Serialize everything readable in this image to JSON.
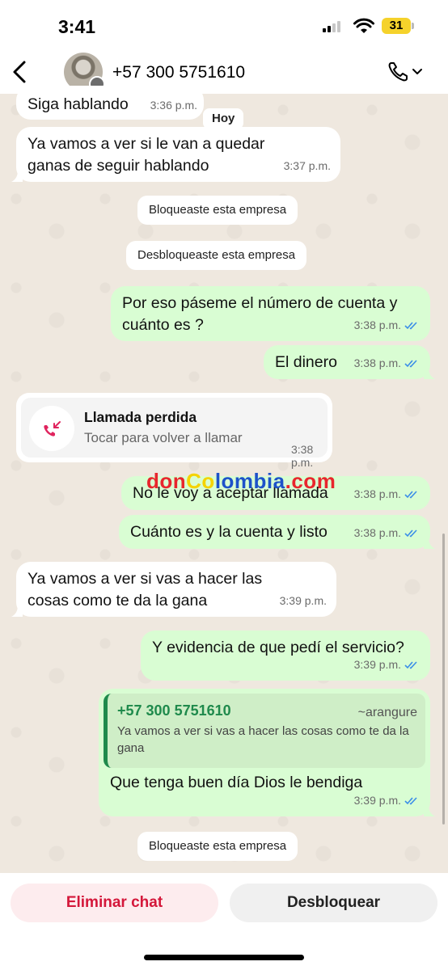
{
  "status_bar": {
    "time": "3:41",
    "battery": "31"
  },
  "header": {
    "contact": "+57 300 5751610"
  },
  "day_label": "Hoy",
  "messages": [
    {
      "text": "Siga hablando",
      "time": "3:36 p.m."
    },
    {
      "text": "Ya vamos a ver si le van a quedar ganas de seguir hablando",
      "time": "3:37 p.m."
    },
    {
      "text": "Por eso páseme el número de cuenta y cuánto es ?",
      "time": "3:38 p.m."
    },
    {
      "text": "El dinero",
      "time": "3:38 p.m."
    },
    {
      "text": "No le voy a aceptar llamada",
      "time": "3:38 p.m."
    },
    {
      "text": "Cuánto es y la cuenta y listo",
      "time": "3:38 p.m."
    },
    {
      "text": "Ya vamos a ver si vas a hacer las cosas como te da la gana",
      "time": "3:39 p.m."
    },
    {
      "text": "Y evidencia de que pedí el servicio?",
      "time": "3:39 p.m."
    },
    {
      "text": "Que tenga buen día Dios le bendiga",
      "time": "3:39 p.m."
    }
  ],
  "system": {
    "blocked": "Bloqueaste esta empresa",
    "unblocked": "Desbloqueaste esta empresa",
    "blocked_again": "Bloqueaste esta empresa"
  },
  "missed_call": {
    "title": "Llamada perdida",
    "subtitle": "Tocar para volver a llamar",
    "time": "3:38 p.m."
  },
  "quote": {
    "author": "+57 300 5751610",
    "alias": "~arangure",
    "text": "Ya vamos a ver si vas a hacer las cosas como te da la gana"
  },
  "watermark": {
    "part1": "don",
    "part2": "Co",
    "part3": "lombia",
    "part4": ".com"
  },
  "actions": {
    "delete": "Eliminar chat",
    "unblock": "Desbloquear"
  },
  "colors": {
    "outgoing": "#d9fdd3",
    "incoming": "#ffffff",
    "read_ticks": "#3b8ee8",
    "delete": "#d4173a"
  }
}
